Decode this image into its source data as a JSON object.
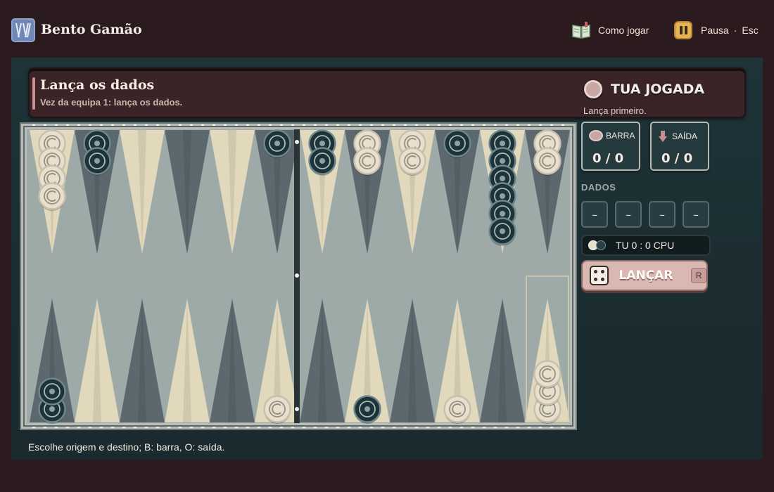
{
  "header": {
    "app_title": "Bento Gamão",
    "how_to_play": "Como jogar",
    "pause": "Pausa",
    "pause_separator": "·",
    "pause_key": "Esc"
  },
  "banner": {
    "title": "Lança os dados",
    "subtitle": "Vez da equipa 1: lança os dados."
  },
  "status_line": "Escolhe origem e destino; B: barra, O: saída.",
  "side_panel": {
    "turn_title": "TUA JOGADA",
    "turn_subtitle": "Lança primeiro.",
    "bar": {
      "label": "BARRA",
      "value": "0 / 0"
    },
    "bear_off": {
      "label": "SAÍDA",
      "value": "0 / 0"
    },
    "dice_label": "DADOS",
    "dice": [
      "–",
      "–",
      "–",
      "–"
    ],
    "score": "TU 0 : 0 CPU",
    "roll_button": "LANÇAR",
    "roll_key": "R"
  },
  "board": {
    "top_row": [
      {
        "color": "light",
        "count": 4
      },
      {
        "color": "dark",
        "count": 2
      },
      {
        "color": null,
        "count": 0
      },
      {
        "color": null,
        "count": 0
      },
      {
        "color": null,
        "count": 0
      },
      {
        "color": "dark",
        "count": 1
      },
      {
        "color": "dark",
        "count": 2
      },
      {
        "color": "light",
        "count": 2
      },
      {
        "color": "light",
        "count": 2
      },
      {
        "color": "dark",
        "count": 1
      },
      {
        "color": "dark",
        "count": 6
      },
      {
        "color": "light",
        "count": 2
      }
    ],
    "bottom_row": [
      {
        "color": "dark",
        "count": 2
      },
      {
        "color": null,
        "count": 0
      },
      {
        "color": null,
        "count": 0
      },
      {
        "color": null,
        "count": 0
      },
      {
        "color": null,
        "count": 0
      },
      {
        "color": "light",
        "count": 1
      },
      {
        "color": null,
        "count": 0
      },
      {
        "color": "dark",
        "count": 1
      },
      {
        "color": null,
        "count": 0
      },
      {
        "color": "light",
        "count": 1
      },
      {
        "color": null,
        "count": 0
      },
      {
        "color": "light",
        "count": 3
      }
    ],
    "highlighted_bottom_point": 11,
    "colors": {
      "felt": "#9eaaa7",
      "point_light": "#e6dbbd",
      "point_dark": "#59636a",
      "checker_light": "#e8e0cf",
      "checker_dark": "#1e3338"
    }
  }
}
